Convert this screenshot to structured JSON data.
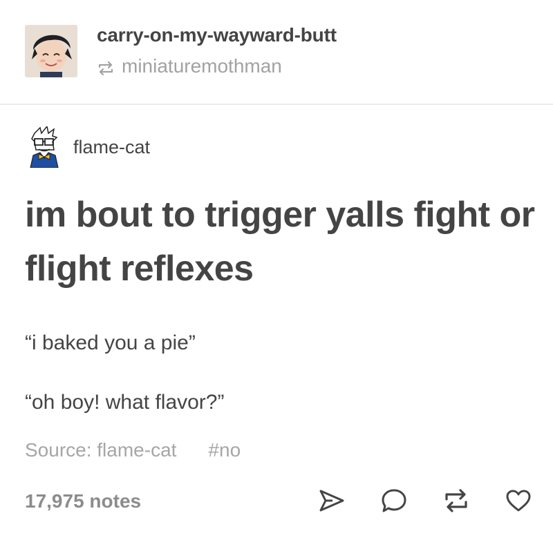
{
  "header": {
    "username": "carry-on-my-wayward-butt",
    "reblogged_from": "miniaturemothman",
    "avatar_icon": "user-avatar-icon",
    "reblog_icon": "reblog-icon"
  },
  "post": {
    "author": "flame-cat",
    "title": "im bout to trigger yalls fight or flight reflexes",
    "lines": [
      "“i baked you a pie”",
      "“oh boy! what flavor?”"
    ],
    "source_label": "Source: flame-cat",
    "tag": "#no"
  },
  "footer": {
    "notes": "17,975 notes",
    "actions": [
      "share-icon",
      "reply-icon",
      "reblog-icon",
      "like-icon"
    ]
  },
  "colors": {
    "text": "#444444",
    "muted": "#a6a6a6",
    "divider": "#ececec"
  }
}
